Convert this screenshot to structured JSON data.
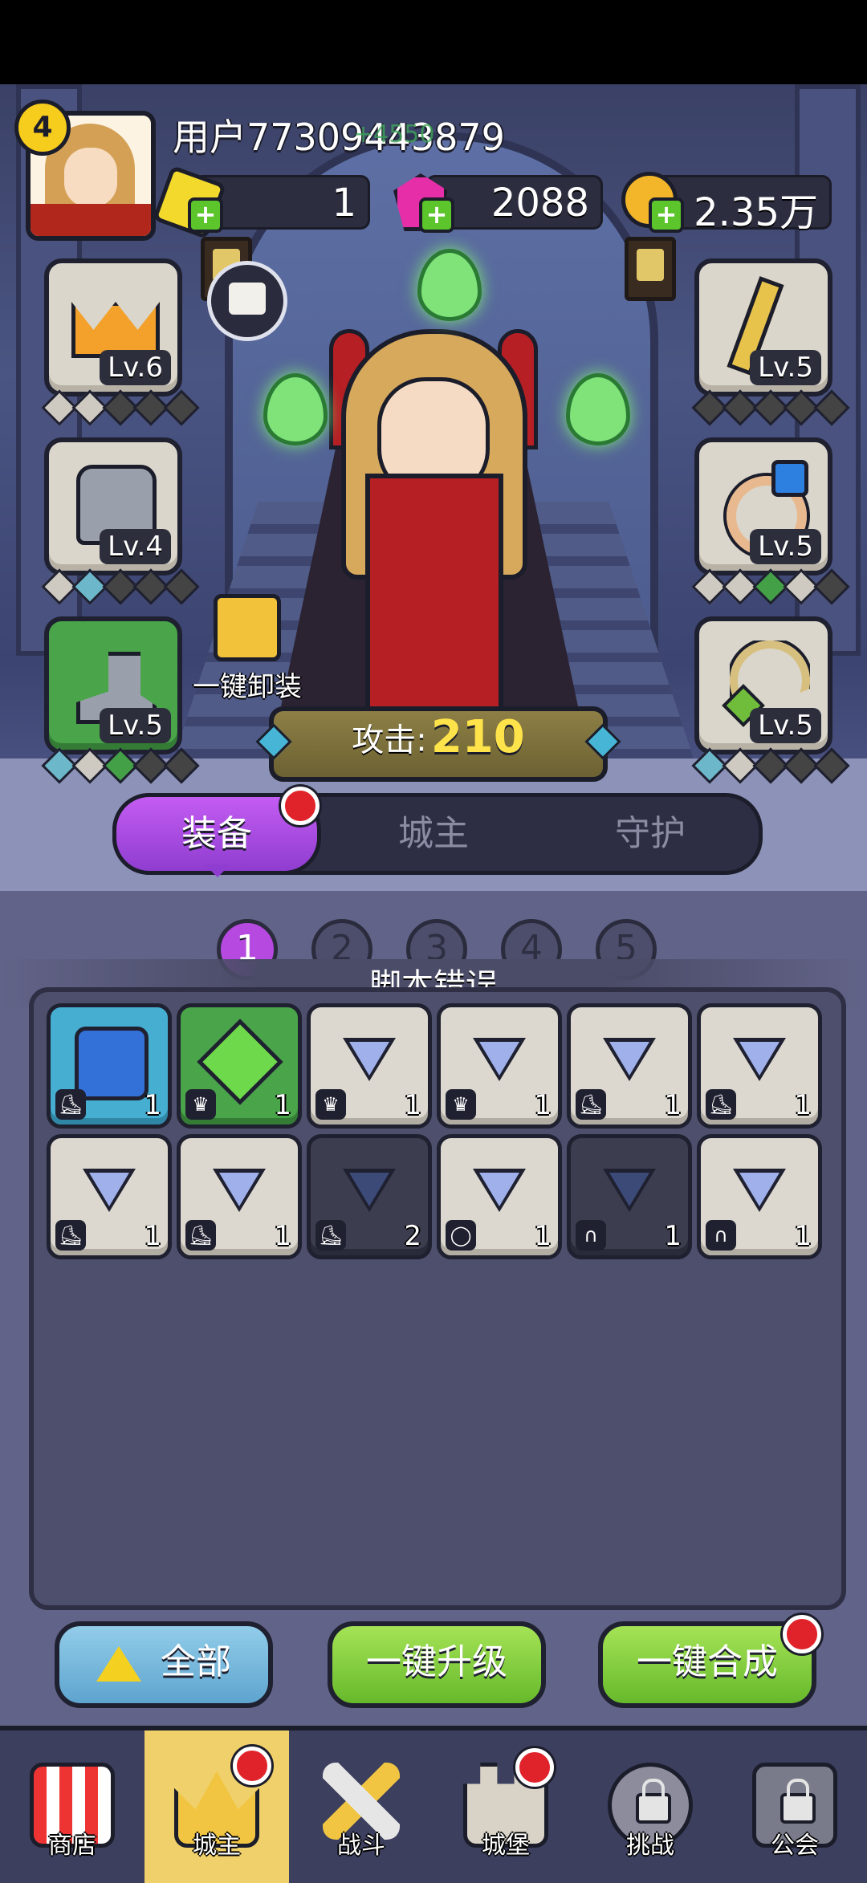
{
  "player": {
    "level": "4",
    "username": "用户77309443879",
    "overlay_text": "+4550"
  },
  "resources": {
    "gold_gems": "1",
    "pink_gems": "2088",
    "coins": "2.35万"
  },
  "equipment_left": [
    {
      "name": "crown",
      "level": "Lv.6"
    },
    {
      "name": "armor",
      "level": "Lv.4"
    },
    {
      "name": "boots",
      "level": "Lv.5"
    }
  ],
  "equipment_right": [
    {
      "name": "staff",
      "level": "Lv.5"
    },
    {
      "name": "ring",
      "level": "Lv.5"
    },
    {
      "name": "necklace",
      "level": "Lv.5"
    }
  ],
  "unequip_label": "一键卸装",
  "attack": {
    "label": "攻击:",
    "value": "210"
  },
  "tabs": [
    "装备",
    "城主",
    "守护"
  ],
  "pages": [
    "1",
    "2",
    "3",
    "4",
    "5"
  ],
  "banner_text": "脚本错误",
  "inventory": [
    {
      "style": "blue",
      "icon": "blue-gem",
      "type": "boot",
      "count": "1"
    },
    {
      "style": "green",
      "icon": "green-gem",
      "type": "crown",
      "count": "1"
    },
    {
      "style": "light",
      "icon": "triangle",
      "type": "crown",
      "count": "1"
    },
    {
      "style": "light",
      "icon": "triangle",
      "type": "crown",
      "count": "1"
    },
    {
      "style": "light",
      "icon": "triangle",
      "type": "boot",
      "count": "1"
    },
    {
      "style": "light",
      "icon": "triangle",
      "type": "boot",
      "count": "1"
    },
    {
      "style": "light",
      "icon": "triangle",
      "type": "boot",
      "count": "1"
    },
    {
      "style": "light",
      "icon": "triangle",
      "type": "boot",
      "count": "1"
    },
    {
      "style": "dark",
      "icon": "triangle",
      "type": "boot",
      "count": "2"
    },
    {
      "style": "light",
      "icon": "triangle",
      "type": "ring",
      "count": "1"
    },
    {
      "style": "dark",
      "icon": "triangle",
      "type": "necklace",
      "count": "1"
    },
    {
      "style": "light",
      "icon": "triangle",
      "type": "necklace",
      "count": "1"
    }
  ],
  "buttons": {
    "all": "全部",
    "upgrade": "一键升级",
    "synthesize": "一键合成"
  },
  "nav": [
    "商店",
    "城主",
    "战斗",
    "城堡",
    "挑战",
    "公会"
  ],
  "colors": {
    "accent_purple": "#b649e0",
    "green_button": "#66b92b",
    "nav_active": "#f0d06a"
  }
}
